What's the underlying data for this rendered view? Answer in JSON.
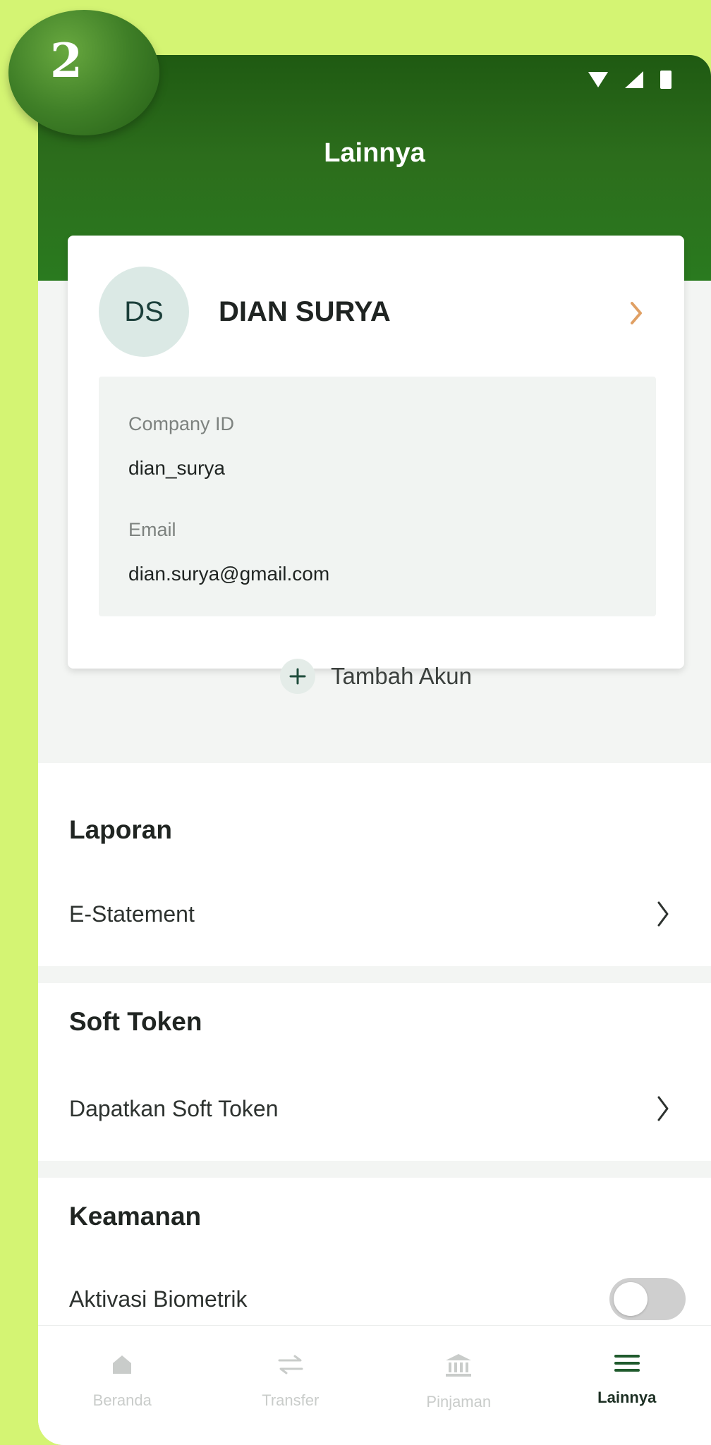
{
  "step_badge": "2",
  "header": {
    "title": "Lainnya"
  },
  "profile": {
    "initials": "DS",
    "name": "DIAN SURYA",
    "company_id_label": "Company ID",
    "company_id_value": "dian_surya",
    "email_label": "Email",
    "email_value": "dian.surya@gmail.com",
    "add_account_label": "Tambah Akun"
  },
  "sections": {
    "laporan": {
      "title": "Laporan",
      "row_label": "E-Statement"
    },
    "soft_token": {
      "title": "Soft Token",
      "row_label": "Dapatkan Soft Token"
    },
    "keamanan": {
      "title": "Keamanan",
      "row_label": "Aktivasi Biometrik",
      "toggle_on": false
    }
  },
  "bottom_nav": [
    {
      "label": "Beranda",
      "icon": "home-icon",
      "active": false
    },
    {
      "label": "Transfer",
      "icon": "transfer-icon",
      "active": false
    },
    {
      "label": "Pinjaman",
      "icon": "bank-icon",
      "active": false
    },
    {
      "label": "Lainnya",
      "icon": "menu-icon",
      "active": true
    }
  ],
  "colors": {
    "accent_green": "#2c6d1c",
    "chevron_orange": "#e0a064",
    "background_lime": "#d4f473"
  }
}
